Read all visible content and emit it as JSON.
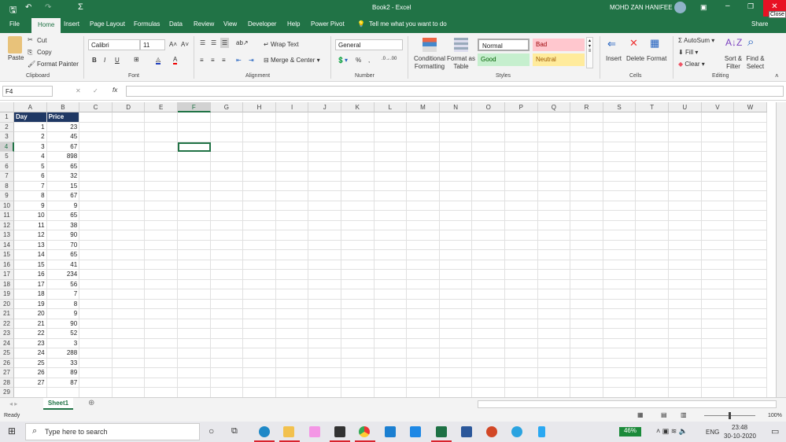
{
  "window": {
    "title": "Book2 - Excel",
    "user": "MOHD ZAN HANIFEE",
    "close_tooltip": "Close"
  },
  "tabs": [
    "File",
    "Home",
    "Insert",
    "Page Layout",
    "Formulas",
    "Data",
    "Review",
    "View",
    "Developer",
    "Help",
    "Power Pivot"
  ],
  "tell_me": "Tell me what you want to do",
  "share": "Share",
  "clipboard": {
    "paste": "Paste",
    "cut": "Cut",
    "copy": "Copy",
    "format_painter": "Format Painter",
    "label": "Clipboard"
  },
  "font": {
    "name": "Calibri",
    "size": "11",
    "bold": "B",
    "italic": "I",
    "underline": "U",
    "label": "Font"
  },
  "alignment": {
    "wrap": "Wrap Text",
    "merge": "Merge & Center",
    "label": "Alignment"
  },
  "number": {
    "format": "General",
    "percent": "%",
    "comma": ",",
    "label": "Number"
  },
  "styles": {
    "cond": "Conditional Formatting",
    "table": "Format as Table",
    "normal": "Normal",
    "bad": "Bad",
    "good": "Good",
    "neutral": "Neutral",
    "label": "Styles"
  },
  "cells": {
    "insert": "Insert",
    "delete": "Delete",
    "format": "Format",
    "label": "Cells"
  },
  "editing": {
    "autosum": "AutoSum",
    "fill": "Fill",
    "clear": "Clear",
    "sort": "Sort & Filter",
    "find": "Find & Select",
    "label": "Editing"
  },
  "formula_bar": {
    "name_box": "F4",
    "fx": "fx",
    "value": ""
  },
  "columns": [
    "A",
    "B",
    "C",
    "D",
    "E",
    "F",
    "G",
    "H",
    "I",
    "J",
    "K",
    "L",
    "M",
    "N",
    "O",
    "P",
    "Q",
    "R",
    "S",
    "T",
    "U",
    "V",
    "W"
  ],
  "headers": [
    "Day",
    "Price"
  ],
  "days": [
    1,
    2,
    3,
    4,
    5,
    6,
    7,
    8,
    9,
    10,
    11,
    12,
    13,
    14,
    15,
    16,
    17,
    18,
    19,
    20,
    21,
    22,
    23,
    24,
    25,
    26,
    27
  ],
  "prices": [
    23,
    45,
    67,
    898,
    65,
    32,
    15,
    67,
    9,
    65,
    38,
    90,
    70,
    65,
    41,
    234,
    56,
    7,
    8,
    9,
    90,
    52,
    3,
    288,
    33,
    89,
    87
  ],
  "row_count": 29,
  "selected_cell": "F4",
  "sheet_tab": "Sheet1",
  "status": {
    "ready": "Ready",
    "zoom": "100%"
  },
  "taskbar": {
    "search": "Type here to search",
    "battery": "46%",
    "lang": "ENG",
    "time": "23:48",
    "date": "30-10-2020"
  },
  "colors": {
    "excel_green": "#217346",
    "header_fill": "#1f3864"
  }
}
